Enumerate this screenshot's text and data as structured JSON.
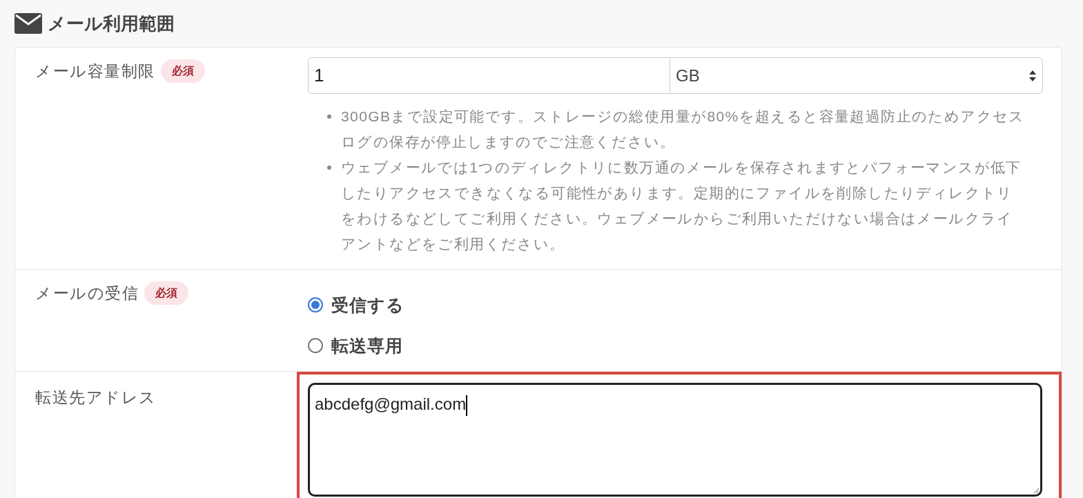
{
  "section": {
    "title": "メール利用範囲"
  },
  "rows": [
    {
      "kind": "quota",
      "label": "メール容量制限",
      "badge": "必須",
      "value": "1",
      "unit": "GB",
      "notes": [
        "300GBまで設定可能です。ストレージの総使用量が80%を超えると容量超過防止のためアクセスログの保存が停止しますのでご注意ください。",
        "ウェブメールでは1つのディレクトリに数万通のメールを保存されますとパフォーマンスが低下したりアクセスできなくなる可能性があります。定期的にファイルを削除したりディレクトリをわけるなどしてご利用ください。ウェブメールからご利用いただけない場合はメールクライアントなどをご利用ください。"
      ]
    },
    {
      "kind": "radio",
      "label": "メールの受信",
      "badge": "必須",
      "options": [
        {
          "label": "受信する",
          "selected": true
        },
        {
          "label": "転送専用",
          "selected": false
        }
      ]
    },
    {
      "kind": "textarea",
      "label": "転送先アドレス",
      "value": "abcdefg@gmail.com",
      "highlighted": true
    }
  ]
}
